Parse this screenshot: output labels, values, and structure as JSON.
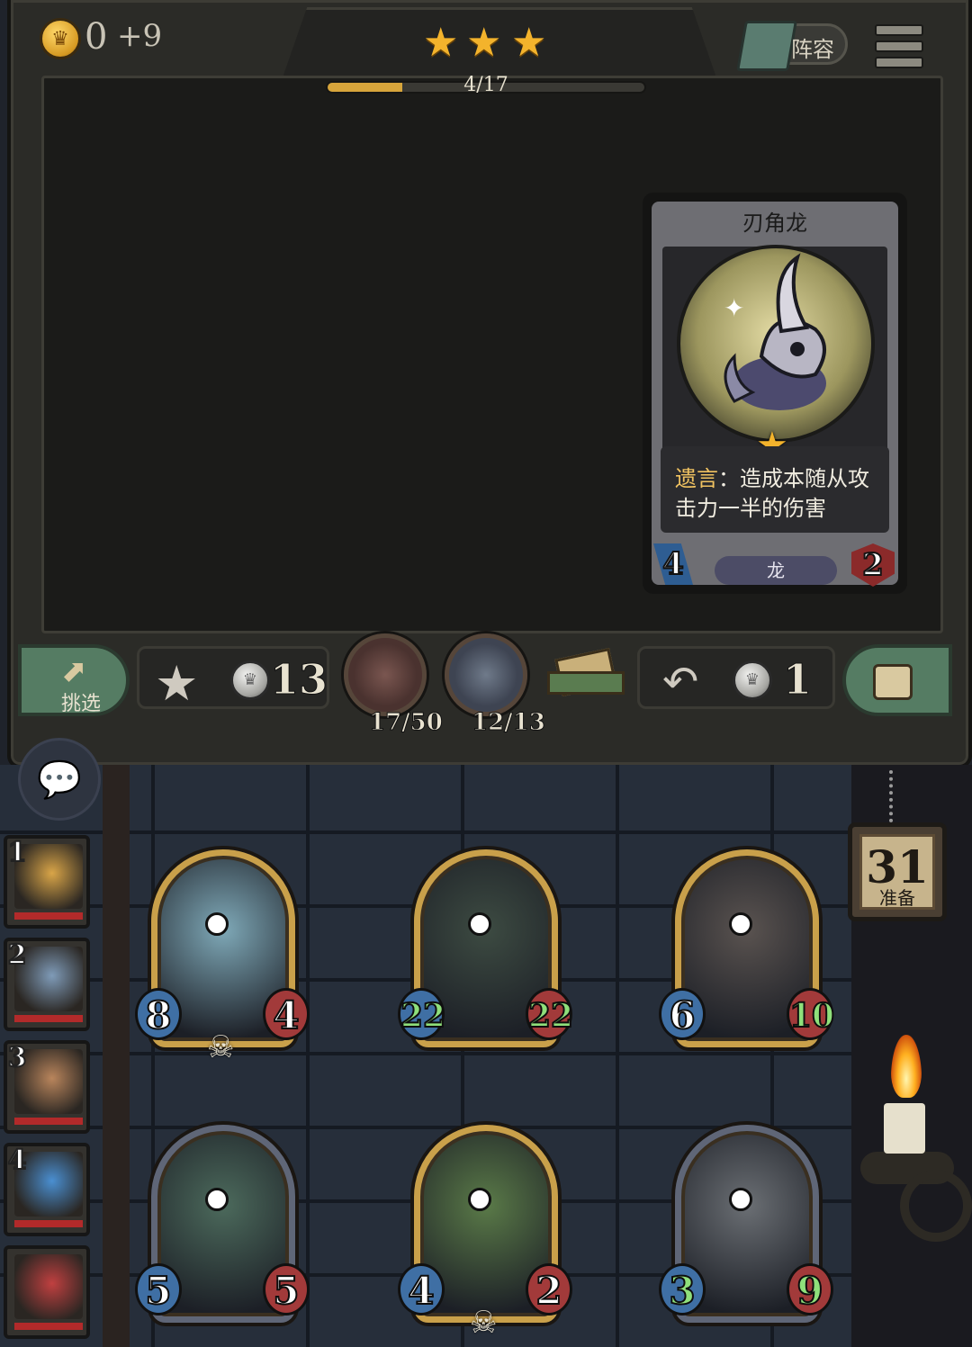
{
  "header": {
    "gold": "0",
    "gold_income": "+9",
    "stars": 3,
    "progress_label": "4/17",
    "progress_value": 0.235,
    "lineup_label": "阵容"
  },
  "detail_card": {
    "name": "刃角龙",
    "keyword": "遗言",
    "text": "：造成本随从攻击力一半的伤害",
    "tribe": "龙",
    "attack": "4",
    "health": "2",
    "tier_stars": 1
  },
  "shop_bar": {
    "pick_label": "挑选",
    "upgrade_cost": "13",
    "watch1_label": "17/50",
    "watch2_label": "12/13",
    "refresh_cost": "1"
  },
  "prep": {
    "count": "31",
    "label": "准备"
  },
  "players": [
    {
      "rank": "1",
      "color": "#d9a548"
    },
    {
      "rank": "2",
      "color": "#7f9bb8"
    },
    {
      "rank": "3",
      "color": "#b9855c"
    },
    {
      "rank": "4",
      "color": "#4a8fd1"
    },
    {
      "rank": "",
      "color": "#c04040"
    }
  ],
  "board": [
    {
      "attack": "8",
      "health": "4",
      "skull": true,
      "frame": "gold",
      "art": "#7fa9b8"
    },
    {
      "attack": "22",
      "health": "22",
      "skull": false,
      "frame": "gold",
      "art": "#3d4b42",
      "green": true
    },
    {
      "attack": "6",
      "health": "10",
      "skull": false,
      "frame": "gold",
      "art": "#5a5350",
      "hp_green": true
    },
    {
      "attack": "5",
      "health": "5",
      "skull": false,
      "frame": "silver",
      "art": "#4c6a5c"
    },
    {
      "attack": "4",
      "health": "2",
      "skull": true,
      "frame": "gold",
      "art": "#5a7a48"
    },
    {
      "attack": "3",
      "health": "9",
      "skull": false,
      "frame": "silver",
      "art": "#6b6f74",
      "green": true
    }
  ],
  "colors": {
    "accent_gold": "#f3b32c",
    "panel": "#2b2b27",
    "button_green": "#557c63",
    "attack_blue": "#3f6fa4",
    "health_red": "#a23a3a"
  }
}
